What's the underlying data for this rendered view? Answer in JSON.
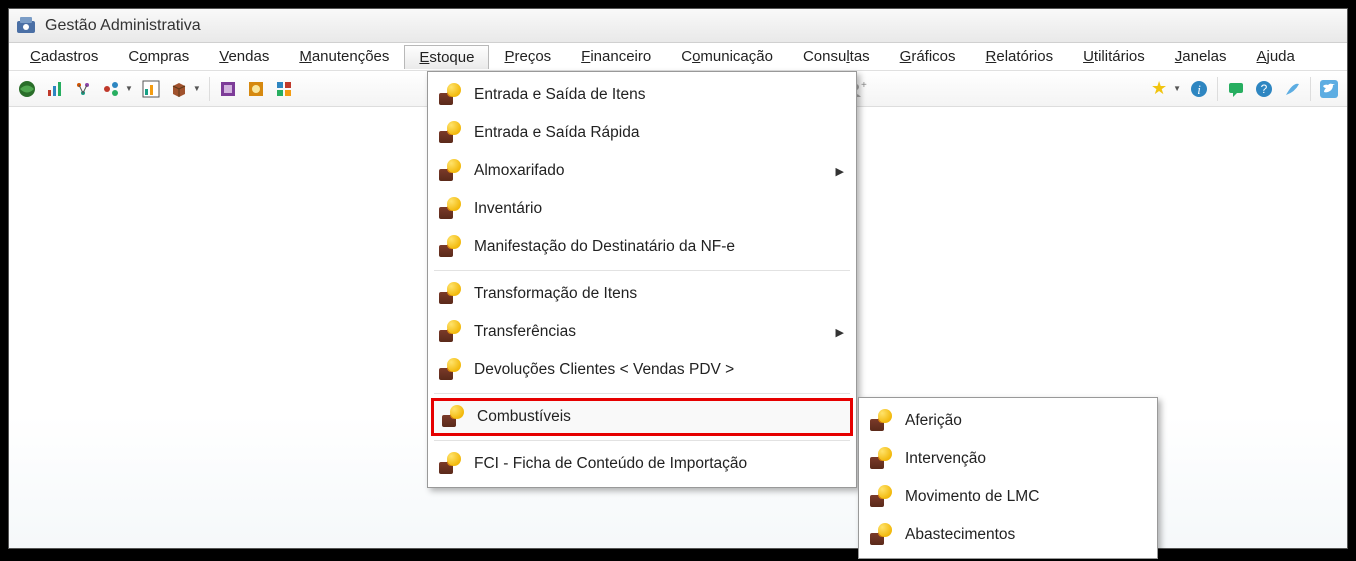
{
  "window": {
    "title": "Gestão Administrativa"
  },
  "menubar": {
    "items": [
      {
        "label": "Cadastros",
        "ul": "C"
      },
      {
        "label": "Compras",
        "ul": "o"
      },
      {
        "label": "Vendas",
        "ul": "V"
      },
      {
        "label": "Manutenções",
        "ul": "M"
      },
      {
        "label": "Estoque",
        "ul": "E",
        "active": true
      },
      {
        "label": "Preços",
        "ul": "P"
      },
      {
        "label": "Financeiro",
        "ul": "F"
      },
      {
        "label": "Comunicação",
        "ul": "o"
      },
      {
        "label": "Consultas",
        "ul": "l"
      },
      {
        "label": "Gráficos",
        "ul": "G"
      },
      {
        "label": "Relatórios",
        "ul": "R"
      },
      {
        "label": "Utilitários",
        "ul": "U"
      },
      {
        "label": "Janelas",
        "ul": "J"
      },
      {
        "label": "Ajuda",
        "ul": "A"
      }
    ]
  },
  "estoque_menu": {
    "groups": [
      [
        {
          "label": "Entrada e Saída de Itens"
        },
        {
          "label": "Entrada e Saída Rápida"
        },
        {
          "label": "Almoxarifado",
          "submenu": true
        },
        {
          "label": "Inventário"
        },
        {
          "label": "Manifestação do Destinatário da NF-e"
        }
      ],
      [
        {
          "label": "Transformação de Itens"
        },
        {
          "label": "Transferências",
          "submenu": true
        },
        {
          "label": "Devoluções Clientes < Vendas PDV >"
        }
      ],
      [
        {
          "label": "Combustíveis",
          "highlighted": true,
          "submenu_open": true
        }
      ],
      [
        {
          "label": "FCI - Ficha de Conteúdo de Importação"
        }
      ]
    ]
  },
  "combustiveis_submenu": {
    "items": [
      {
        "label": "Aferição"
      },
      {
        "label": "Intervenção"
      },
      {
        "label": "Movimento de LMC"
      },
      {
        "label": "Abastecimentos"
      }
    ]
  },
  "toolbar": {
    "left_icons": [
      "globe",
      "bars-colored",
      "tree",
      "nodes",
      "chart-box",
      "box-3d",
      "purple-square",
      "orange-square",
      "grid-colored"
    ],
    "right_icons": [
      "orange-circle",
      "lock",
      "printer",
      "face-gray",
      "person-add"
    ],
    "far_icons": [
      "star",
      "info",
      "chat-green",
      "help-blue",
      "feather",
      "twitter"
    ]
  }
}
